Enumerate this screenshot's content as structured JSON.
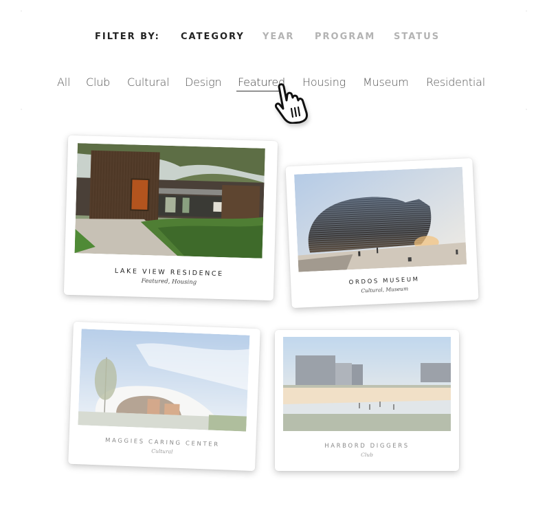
{
  "filter": {
    "label": "FILTER BY:",
    "tabs": [
      {
        "label": "CATEGORY",
        "active": true
      },
      {
        "label": "YEAR",
        "active": false
      },
      {
        "label": "PROGRAM",
        "active": false
      },
      {
        "label": "STATUS",
        "active": false
      }
    ]
  },
  "categories": {
    "items": [
      "All",
      "Club",
      "Cultural",
      "Design",
      "Featured",
      "Housing",
      "Museum",
      "Residential"
    ],
    "hovered": "Featured"
  },
  "cursor": {
    "icon": "hand-pointer-icon"
  },
  "projects": [
    {
      "title": "LAKE VIEW RESIDENCE",
      "categories": "Featured, Housing",
      "highlighted": true
    },
    {
      "title": "ORDOS MUSEUM",
      "categories": "Cultural, Museum",
      "highlighted": true
    },
    {
      "title": "MAGGIES CARING CENTER",
      "categories": "Cultural",
      "highlighted": false
    },
    {
      "title": "HARBORD DIGGERS",
      "categories": "Club",
      "highlighted": false
    }
  ],
  "colors": {
    "active_text": "#222222",
    "inactive_text": "#b3b3b3",
    "category_text": "#555555"
  }
}
